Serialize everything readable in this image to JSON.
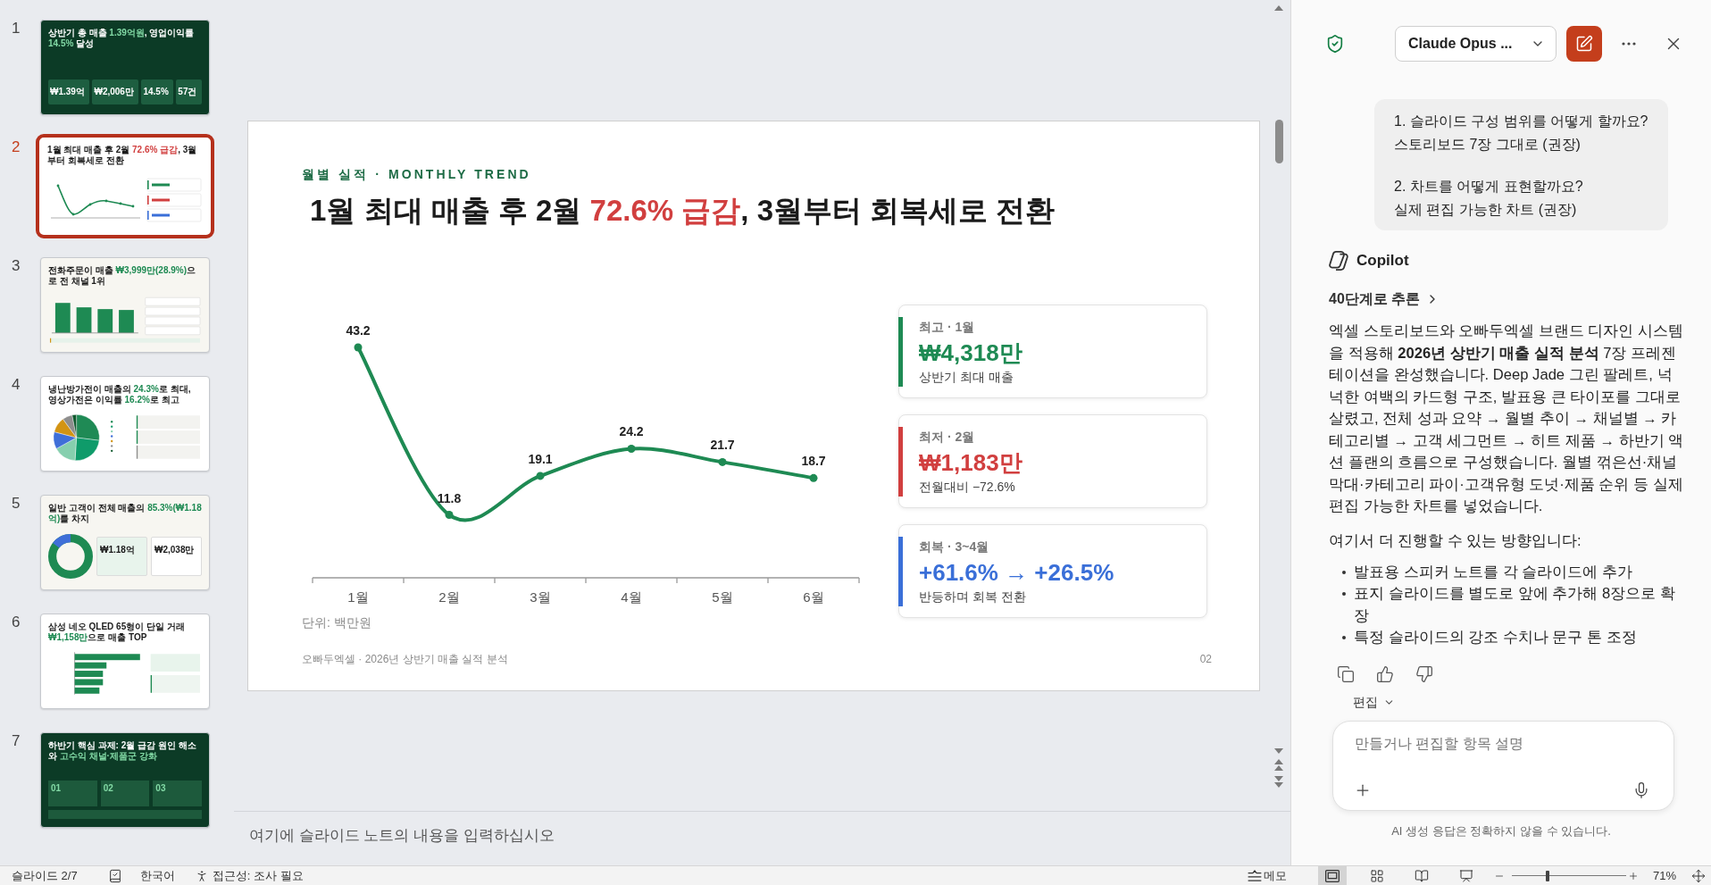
{
  "thumbnails": [
    {
      "number": "1",
      "selected": false,
      "kind": "kpi",
      "title": [
        {
          "text": "상반기 총 매출 ",
          "color": "#ffffff"
        },
        {
          "text": "1.39억원",
          "color": "#82d9a5"
        },
        {
          "text": ", 영업이익률 ",
          "color": "#ffffff"
        },
        {
          "text": "14.5%",
          "color": "#82d9a5"
        },
        {
          "text": " 달성",
          "color": "#ffffff"
        }
      ],
      "figures": [
        "₩1.39억",
        "₩2,006만",
        "14.5%",
        "57건"
      ]
    },
    {
      "number": "2",
      "selected": true,
      "kind": "line",
      "title": [
        {
          "text": "1월 최대 매출 후 2월 ",
          "color": "#1b1b1b"
        },
        {
          "text": "72.6% 급감",
          "color": "#d13f3f"
        },
        {
          "text": ", 3월부터 회복세로 전환",
          "color": "#1b1b1b"
        }
      ]
    },
    {
      "number": "3",
      "selected": false,
      "kind": "bars",
      "title": [
        {
          "text": "전화주문이 매출 ",
          "color": "#1b1b1b"
        },
        {
          "text": "₩3,999만(28.9%)",
          "color": "#1e8a53"
        },
        {
          "text": "으로 전 채널 1위",
          "color": "#1b1b1b"
        }
      ]
    },
    {
      "number": "4",
      "selected": false,
      "kind": "pie",
      "title": [
        {
          "text": "냉난방가전이 매출의 ",
          "color": "#1b1b1b"
        },
        {
          "text": "24.3%",
          "color": "#1e8a53"
        },
        {
          "text": "로 최대, 영상가전은 이익률 ",
          "color": "#1b1b1b"
        },
        {
          "text": "16.2%",
          "color": "#1e8a53"
        },
        {
          "text": "로 최고",
          "color": "#1b1b1b"
        }
      ]
    },
    {
      "number": "5",
      "selected": false,
      "kind": "donut",
      "title": [
        {
          "text": "일반 고객이 전체 매출의 ",
          "color": "#1b1b1b"
        },
        {
          "text": "85.3%(₩1.18억)",
          "color": "#1e8a53"
        },
        {
          "text": "를 차지",
          "color": "#1b1b1b"
        }
      ],
      "figures": [
        "₩1.18억",
        "₩2,038만"
      ]
    },
    {
      "number": "6",
      "selected": false,
      "kind": "hbars",
      "title": [
        {
          "text": "삼성 네오 QLED 65형이 단일 거래 ",
          "color": "#1b1b1b"
        },
        {
          "text": "₩1,158만",
          "color": "#1e8a53"
        },
        {
          "text": "으로 매출 TOP",
          "color": "#1b1b1b"
        }
      ]
    },
    {
      "number": "7",
      "selected": false,
      "kind": "cards",
      "title": [
        {
          "text": "하반기 핵심 과제: 2월 급감 원인 해소와 ",
          "color": "#ffffff"
        },
        {
          "text": "고수익 채널·제품군 강화",
          "color": "#82d9a5"
        }
      ],
      "figures": [
        "01",
        "02",
        "03"
      ]
    }
  ],
  "slide": {
    "kicker": "월별 실적 · MONTHLY TREND",
    "title": [
      {
        "text": "1월 최대 매출 후 2월 ",
        "color": "#1b1b1b"
      },
      {
        "text": "72.6% 급감",
        "color": "#d13f3f"
      },
      {
        "text": ", 3월부터 회복세로 전환",
        "color": "#1b1b1b"
      }
    ],
    "chart_data": {
      "type": "line",
      "categories": [
        "1월",
        "2월",
        "3월",
        "4월",
        "5월",
        "6월"
      ],
      "values": [
        43.2,
        11.8,
        19.1,
        24.2,
        21.7,
        18.7
      ],
      "data_labels": true,
      "marker": true
    },
    "unit_note": "단위: 백만원",
    "cards": [
      {
        "label": "최고 · 1월",
        "value": "₩4,318만",
        "note": "상반기 최대 매출",
        "color": "#1e8a53"
      },
      {
        "label": "최저 · 2월",
        "value": "₩1,183만",
        "note": "전월대비 −72.6%",
        "color": "#d13f3f"
      },
      {
        "label": "회복 · 3~4월",
        "value": "+61.6% → +26.5%",
        "note": "반등하며 회복 전환",
        "color": "#3a6fd8"
      }
    ],
    "footer": "오빠두엑셀 · 2026년 상반기 매출 실적 분석",
    "page": "02"
  },
  "notes": {
    "placeholder": "여기에 슬라이드 노트의 내용을 입력하십시오"
  },
  "copilot": {
    "model_picker": "Claude Opus ...",
    "user_message": [
      [
        "1. 슬라이드 구성 범위를 어떻게 할까요?",
        "스토리보드 7장 그대로 (권장)"
      ],
      [
        "2. 차트를 어떻게 표현할까요?",
        "실제 편집 가능한 차트 (권장)"
      ]
    ],
    "sender": "Copilot",
    "reasoning": {
      "label": "40단계로 추론",
      "expanded": false
    },
    "response": "엑셀 스토리보드와 오빠두엑셀 브랜드 디자인 시스템을 적용해 **2026년 상반기 매출 실적 분석** 7장 프레젠테이션을 완성했습니다. Deep Jade 그린 팔레트, 넉넉한 여백의 카드형 구조, 발표용 큰 타이포를 그대로 살렸고, 전체 성과 요약 → 월별 추이 → 채널별 → 카테고리별 → 고객 세그먼트 → 히트 제품 → 하반기 액션 플랜의 흐름으로 구성했습니다. 월별 꺾은선·채널 막대·카테고리 파이·고객유형 도넛·제품 순위 등 실제 편집 가능한 차트를 넣었습니다.",
    "followup_intro": "여기서 더 진행할 수 있는 방향입니다:",
    "suggestions": [
      "발표용 스피커 노트를 각 슬라이드에 추가",
      "표지 슬라이드를 별도로 앞에 추가해 8장으로 확장",
      "특정 슬라이드의 강조 수치나 문구 톤 조정"
    ],
    "edit_menu": "편집",
    "input": {
      "placeholder": "만들거나 편집할 항목 설명"
    },
    "disclaimer": "AI 생성 응답은 정확하지 않을 수 있습니다."
  },
  "status_bar": {
    "slide_indicator": "슬라이드 2/7",
    "language": "한국어",
    "accessibility": "접근성: 조사 필요",
    "notes_button": "메모",
    "views": [
      {
        "kind": "normal",
        "selected": true
      },
      {
        "kind": "sorter",
        "selected": false
      },
      {
        "kind": "reading",
        "selected": false
      },
      {
        "kind": "slideshow",
        "selected": false
      }
    ],
    "zoom_slider": {
      "level": 0.31
    },
    "zoom": "71%"
  }
}
